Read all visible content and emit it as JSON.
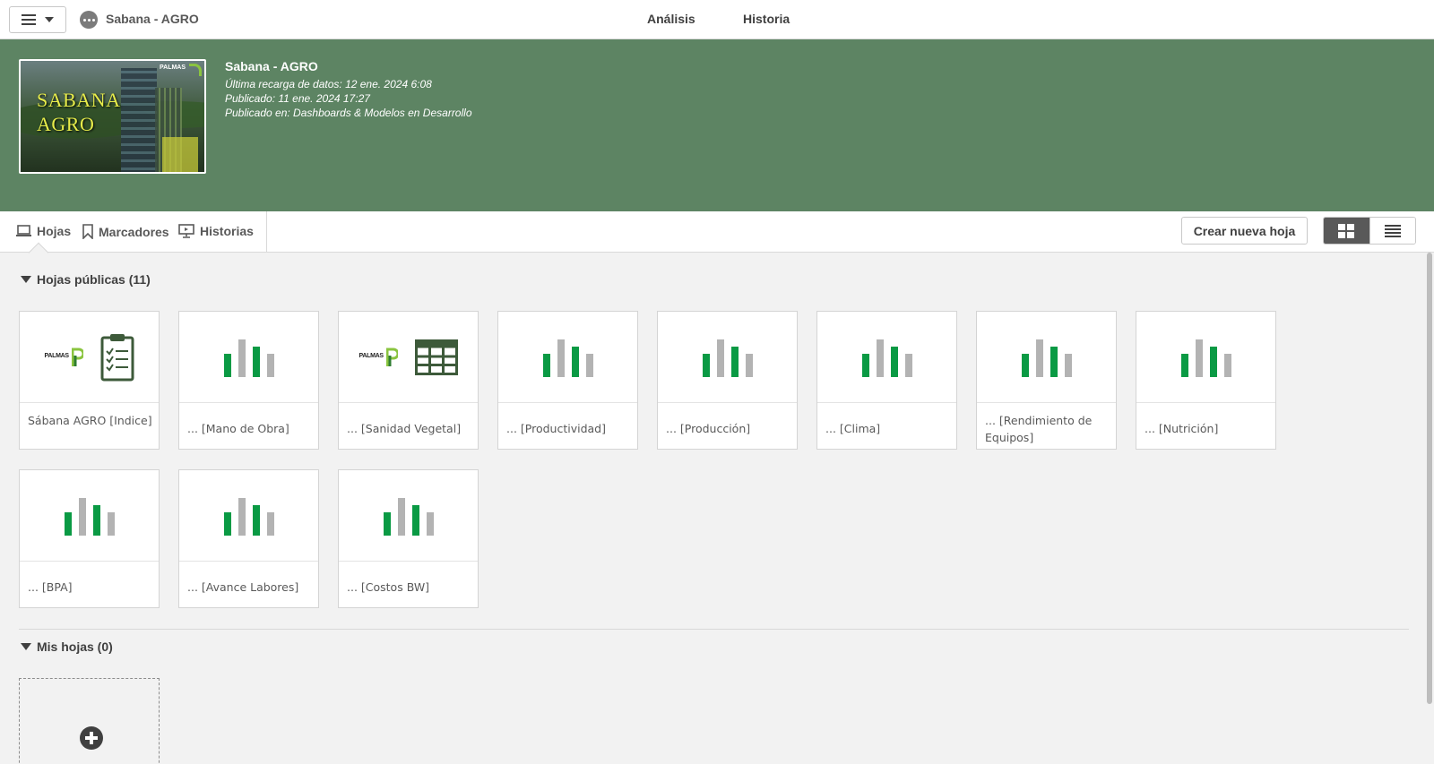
{
  "topbar": {
    "app_name": "Sabana - AGRO",
    "tabs": [
      "Análisis",
      "Historia"
    ]
  },
  "app_info": {
    "thumbnail_title_line1": "SABANA",
    "thumbnail_title_line2": "AGRO",
    "thumbnail_logo": "PALMAS",
    "title": "Sabana - AGRO",
    "last_reload": "Última recarga de datos: 12 ene. 2024 6:08",
    "published": "Publicado: 11 ene. 2024 17:27",
    "published_in": "Publicado en: Dashboards & Modelos en Desarrollo"
  },
  "section_tabs": {
    "hojas": "Hojas",
    "marcadores": "Marcadores",
    "historias": "Historias",
    "create_button": "Crear nueva hoja"
  },
  "public_sheets": {
    "header": "Hojas públicas (11)",
    "items": [
      {
        "label": "Sábana AGRO [Indice]",
        "icon": "clipboard-icon"
      },
      {
        "label": "... [Mano de Obra]",
        "icon": "bar-chart-icon"
      },
      {
        "label": "... [Sanidad Vegetal]",
        "icon": "table-icon"
      },
      {
        "label": "... [Productividad]",
        "icon": "bar-chart-icon"
      },
      {
        "label": "... [Producción]",
        "icon": "bar-chart-icon"
      },
      {
        "label": "... [Clima]",
        "icon": "bar-chart-icon"
      },
      {
        "label": "... [Rendimiento de Equipos]",
        "icon": "bar-chart-icon"
      },
      {
        "label": "... [Nutrición]",
        "icon": "bar-chart-icon"
      },
      {
        "label": "... [BPA]",
        "icon": "bar-chart-icon"
      },
      {
        "label": "... [Avance Labores]",
        "icon": "bar-chart-icon"
      },
      {
        "label": "... [Costos BW]",
        "icon": "bar-chart-icon"
      }
    ],
    "logo_text": "PALMAS"
  },
  "my_sheets": {
    "header": "Mis hojas (0)"
  },
  "colors": {
    "header_band": "#5d8463",
    "bar_green": "#0a9a44",
    "bar_gray": "#b3b3b3",
    "icon_dark_green": "#3d5a3a"
  }
}
